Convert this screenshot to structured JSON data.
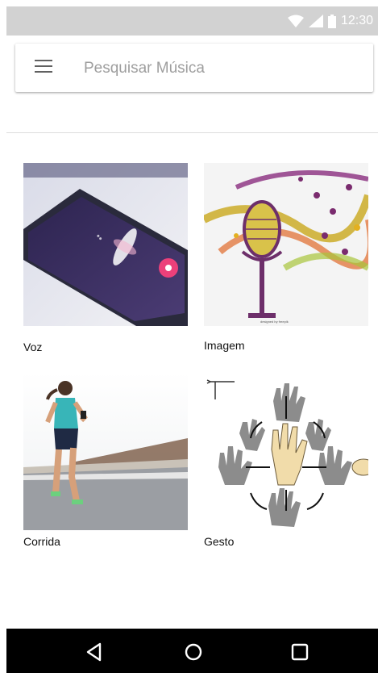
{
  "status_bar": {
    "time": "12:30",
    "icons": [
      "wifi-icon",
      "signal-icon",
      "battery-icon"
    ]
  },
  "search": {
    "placeholder": "Pesquisar Música",
    "value": ""
  },
  "categories": [
    {
      "label": "Voz",
      "icon": "smartphone-voice-image"
    },
    {
      "label": "Imagem",
      "icon": "microphone-music-image"
    },
    {
      "label": "Corrida",
      "icon": "runner-image"
    },
    {
      "label": "Gesto",
      "icon": "hand-gesture-image"
    }
  ],
  "nav_bar": {
    "buttons": [
      "back-icon",
      "home-icon",
      "recents-icon"
    ]
  },
  "colors": {
    "status_bar": "#d2d2d2",
    "nav_bar": "#000000",
    "accent_pink": "#ec407a",
    "phone_purple": "#3c2f5e"
  }
}
